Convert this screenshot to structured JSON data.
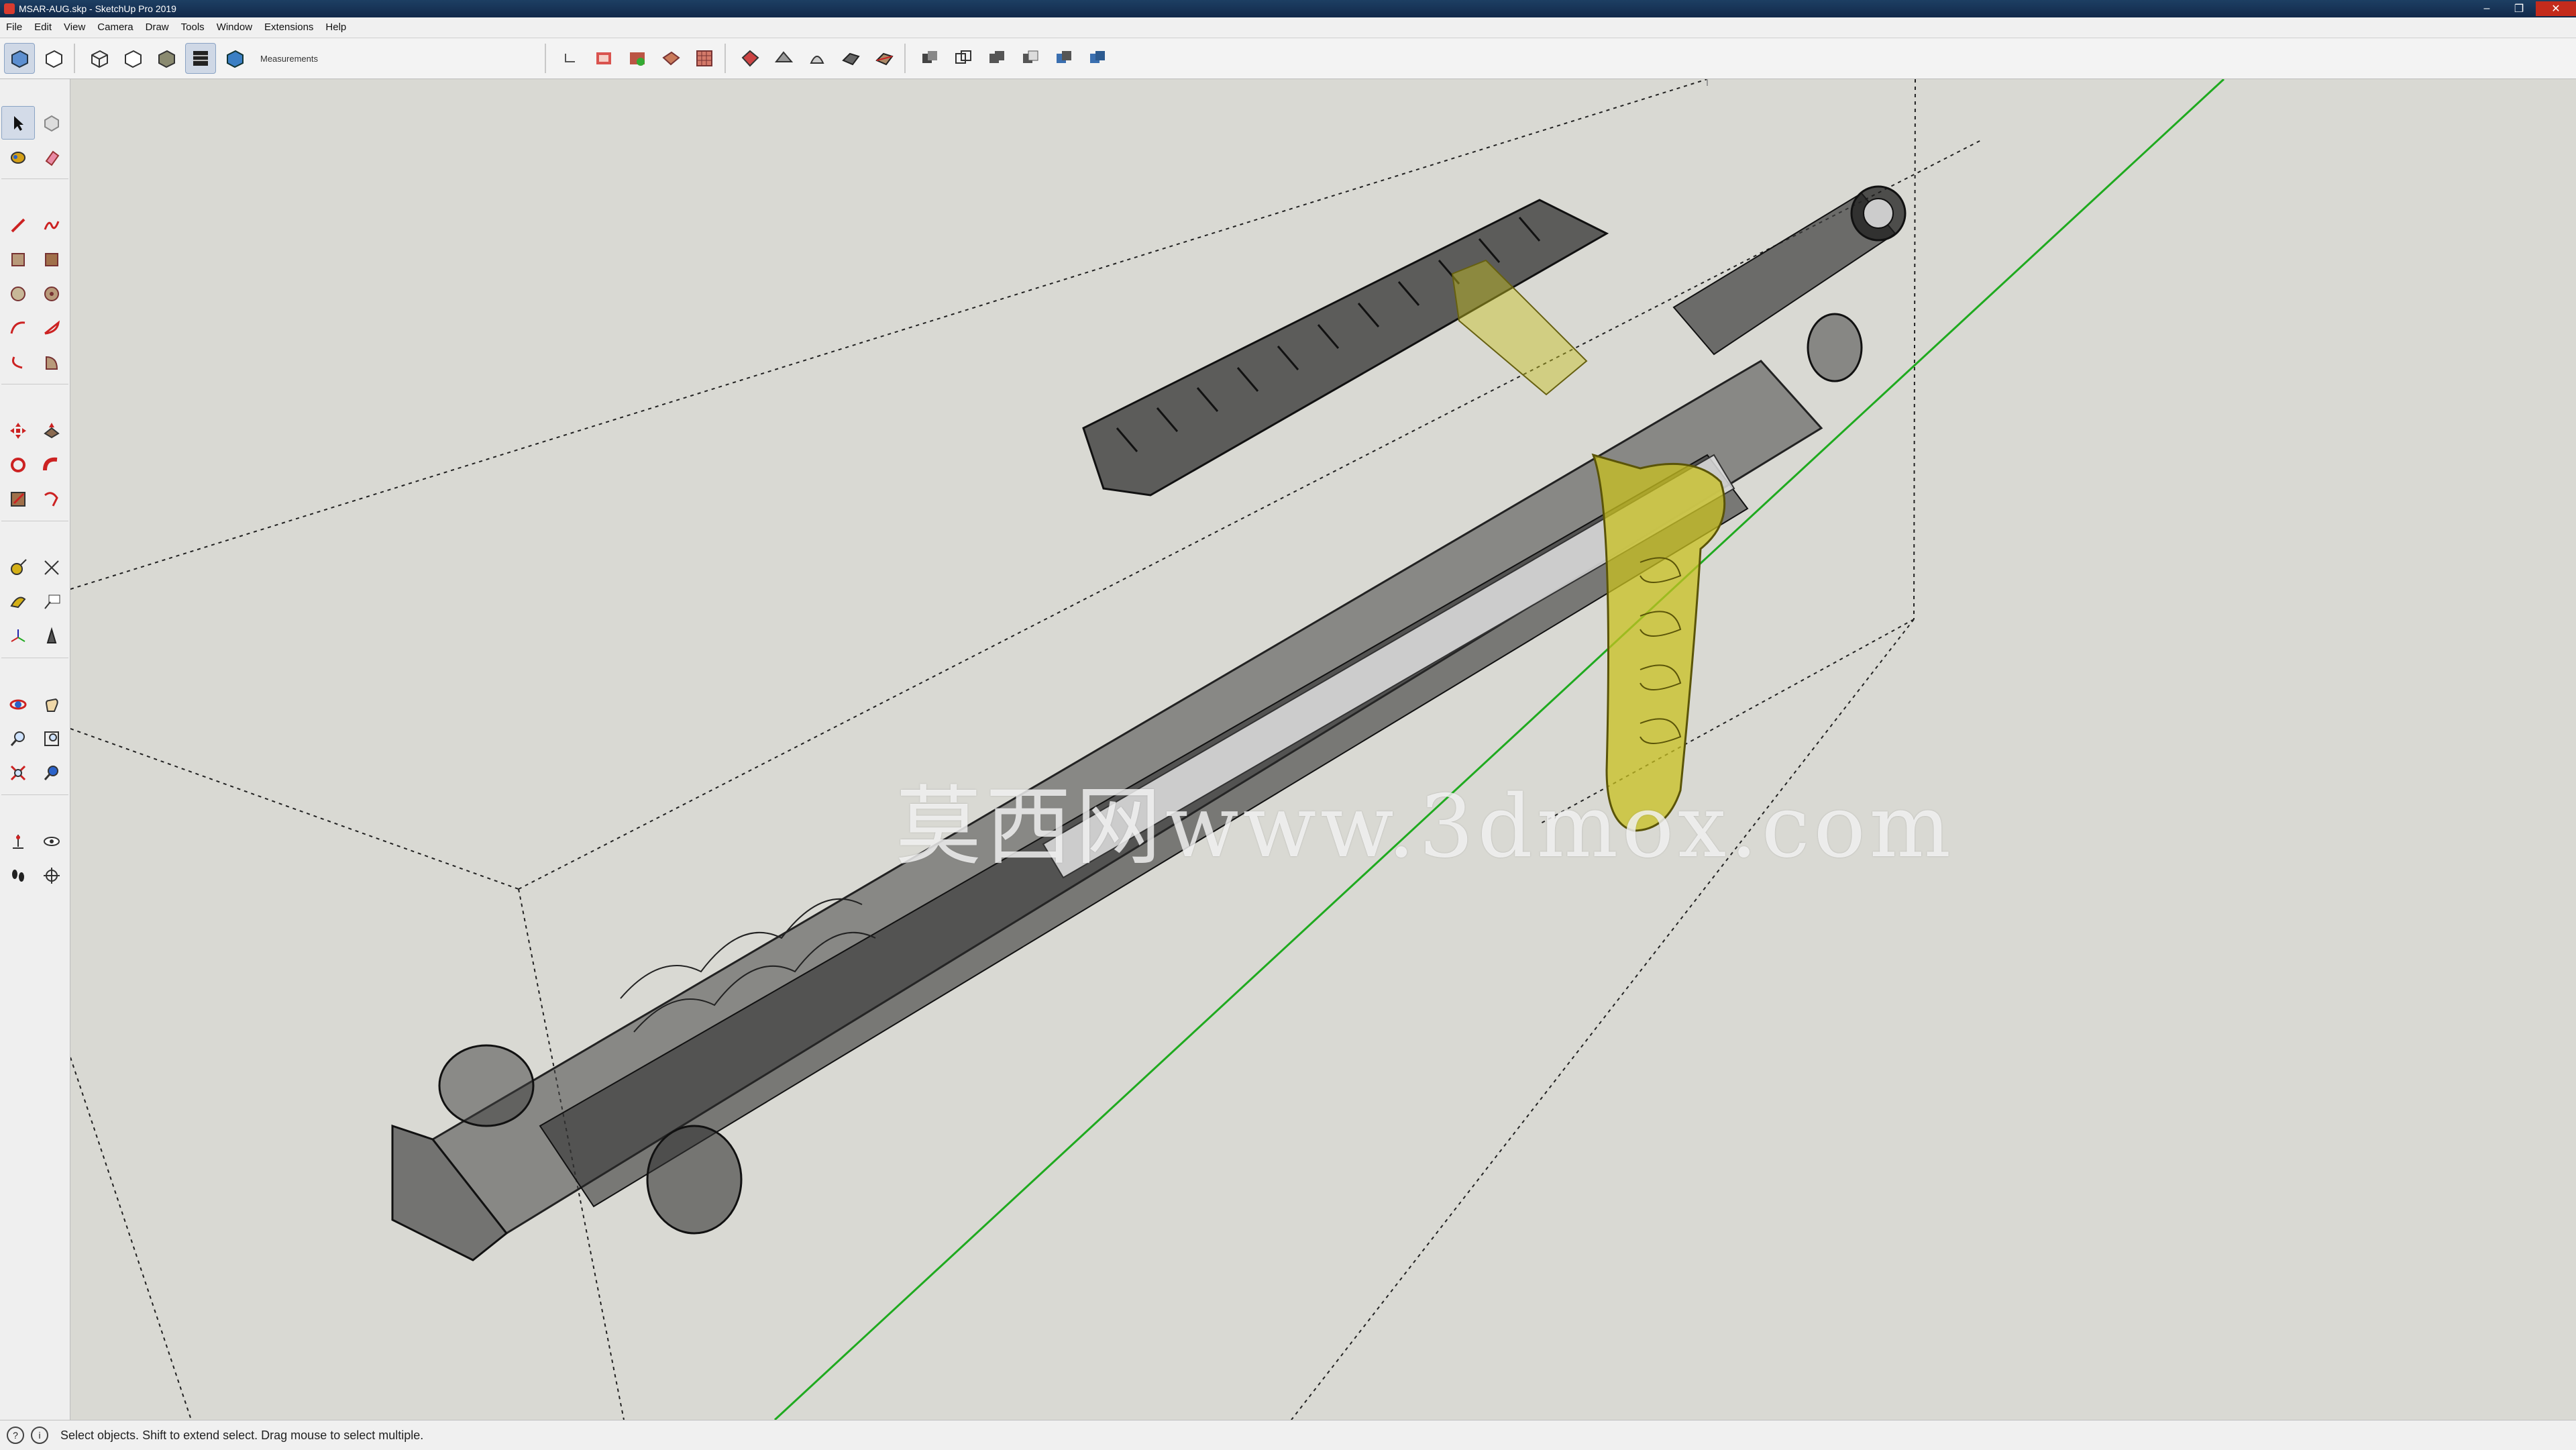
{
  "window": {
    "title": "MSAR-AUG.skp - SketchUp Pro 2019",
    "min_glyph": "–",
    "max_glyph": "❐",
    "close_glyph": "✕"
  },
  "menu": {
    "items": [
      "File",
      "Edit",
      "View",
      "Camera",
      "Draw",
      "Tools",
      "Window",
      "Extensions",
      "Help"
    ]
  },
  "toolbar": {
    "measurements_label": "Measurements",
    "style_buttons": [
      "xray-style",
      "back-edges-style",
      "wireframe-style",
      "hidden-line-style",
      "shaded-style",
      "shaded-textures-style",
      "monochrome-style"
    ],
    "active_style": "shaded-textures-style"
  },
  "viewport": {
    "watermark": "莫西网www.3dmox.com",
    "model_name": "MSAR-AUG",
    "colors": {
      "background": "#d9d9d3",
      "green_axis": "#1faa1f",
      "grip": "#c8c020"
    }
  },
  "statusbar": {
    "message": "Select objects. Shift to extend select. Drag mouse to select multiple."
  }
}
